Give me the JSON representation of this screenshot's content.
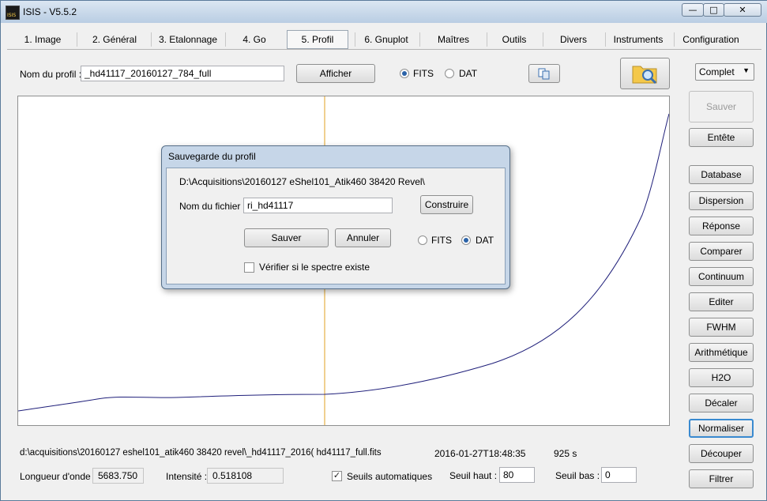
{
  "window": {
    "title": "ISIS - V5.5.2",
    "app_icon_text": "ISIS",
    "min_glyph": "—",
    "max_glyph": "□",
    "close_glyph": "✕"
  },
  "tabs": [
    "1. Image",
    "2. Général",
    "3. Etalonnage",
    "4. Go",
    "5. Profil",
    "6. Gnuplot",
    "Maîtres",
    "Outils",
    "Divers",
    "Instruments",
    "Configuration"
  ],
  "active_tab": "5. Profil",
  "profile": {
    "name_label": "Nom du profil :",
    "name_value": "_hd41117_20160127_784_full",
    "show_button": "Afficher",
    "fits_label": "FITS",
    "dat_label": "DAT",
    "format_selected": "FITS",
    "mode_select": "Complet"
  },
  "sidebar": {
    "save": "Sauver",
    "header": "Entête",
    "buttons": [
      "Database",
      "Dispersion",
      "Réponse",
      "Comparer",
      "Continuum",
      "Editer",
      "FWHM",
      "Arithmétique",
      "H2O",
      "Décaler",
      "Normaliser",
      "Découper",
      "Filtrer"
    ]
  },
  "dialog": {
    "title": "Sauvegarde du profil",
    "path": "D:\\Acquisitions\\20160127 eShel101_Atik460 38420 Revel\\",
    "filename_label": "Nom du fichier :",
    "filename_value": "ri_hd41117",
    "build_button": "Construire",
    "save_button": "Sauver",
    "cancel_button": "Annuler",
    "fits_label": "FITS",
    "dat_label": "DAT",
    "format_selected": "DAT",
    "check_label": "Vérifier si le spectre existe",
    "check_checked": false
  },
  "status": {
    "file_path": "d:\\acquisitions\\20160127 eshel101_atik460 38420 revel\\_hd41117_2016( hd41117_full.fits",
    "date": "2016-01-27T18:48:35",
    "exposure": "925 s",
    "wavelength_label": "Longueur d'onde :",
    "wavelength_value": "5683.750",
    "intensity_label": "Intensité :",
    "intensity_value": "0.518108",
    "auto_thresholds_label": "Seuils automatiques",
    "auto_thresholds_checked": true,
    "high_label": "Seuil haut :",
    "high_value": "80",
    "low_label": "Seuil bas :",
    "low_value": "0"
  },
  "colors": {
    "curve": "#1f1f7a",
    "cursor": "#e0a020",
    "accent": "#2b63a8"
  }
}
